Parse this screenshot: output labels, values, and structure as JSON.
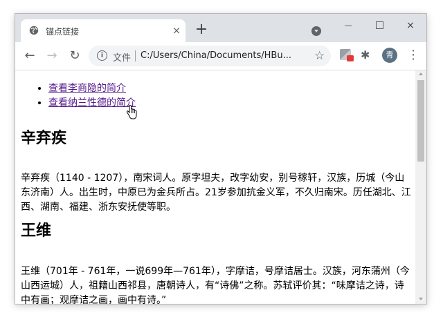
{
  "tab": {
    "title": "锚点链接",
    "favicon": "globe-icon",
    "close_label": "×",
    "new_tab_label": "+"
  },
  "window_controls": {
    "minimize": "minimize-icon",
    "maximize": "maximize-icon",
    "close": "×"
  },
  "toolbar": {
    "back": "←",
    "forward": "→",
    "reload": "↻",
    "security_label": "文件",
    "url": "C:/Users/China/Documents/HBu...",
    "star": "☆",
    "puzzle": "✱",
    "avatar_initial": "青",
    "menu": "⋮"
  },
  "page": {
    "links": [
      {
        "text": "查看李商隐的简介"
      },
      {
        "text": "查看纳兰性德的简介"
      }
    ],
    "sections": [
      {
        "heading": "辛弃疾",
        "body": "辛弃疾（1140 - 1207），南宋词人。原字坦夫，改字幼安，别号稼轩，汉族，历城（今山东济南）人。出生时，中原已为金兵所占。21岁参加抗金义军，不久归南宋。历任湖北、江西、湖南、福建、浙东安抚使等职。"
      },
      {
        "heading": "王维",
        "body": "王维（701年 - 761年，一说699年—761年），字摩诘，号摩诘居士。汉族，河东蒲州（今山西运城）人，祖籍山西祁县，唐朝诗人，有“诗佛”之称。苏轼评价其：“味摩诘之诗，诗中有画；观摩诘之画，画中有诗。”"
      }
    ]
  },
  "colors": {
    "tabstrip": "#dee1e6",
    "visited_link": "#551a8b",
    "omnibox": "#f1f3f4"
  }
}
